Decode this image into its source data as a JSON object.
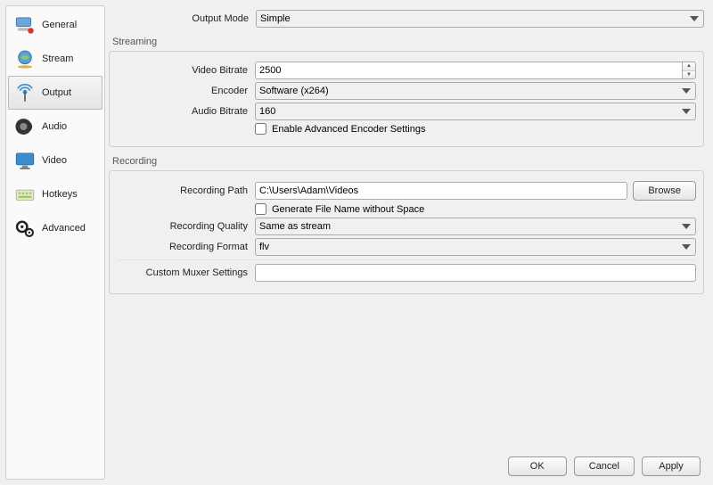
{
  "sidebar": {
    "items": [
      {
        "label": "General"
      },
      {
        "label": "Stream"
      },
      {
        "label": "Output"
      },
      {
        "label": "Audio"
      },
      {
        "label": "Video"
      },
      {
        "label": "Hotkeys"
      },
      {
        "label": "Advanced"
      }
    ]
  },
  "output_mode": {
    "label": "Output Mode",
    "value": "Simple"
  },
  "streaming": {
    "title": "Streaming",
    "video_bitrate": {
      "label": "Video Bitrate",
      "value": "2500"
    },
    "encoder": {
      "label": "Encoder",
      "value": "Software (x264)"
    },
    "audio_bitrate": {
      "label": "Audio Bitrate",
      "value": "160"
    },
    "enable_advanced": {
      "label": "Enable Advanced Encoder Settings"
    }
  },
  "recording": {
    "title": "Recording",
    "path": {
      "label": "Recording Path",
      "value": "C:\\Users\\Adam\\Videos"
    },
    "browse": "Browse",
    "gen_no_space": {
      "label": "Generate File Name without Space"
    },
    "quality": {
      "label": "Recording Quality",
      "value": "Same as stream"
    },
    "format": {
      "label": "Recording Format",
      "value": "flv"
    },
    "mux": {
      "label": "Custom Muxer Settings",
      "value": ""
    }
  },
  "footer": {
    "ok": "OK",
    "cancel": "Cancel",
    "apply": "Apply"
  }
}
